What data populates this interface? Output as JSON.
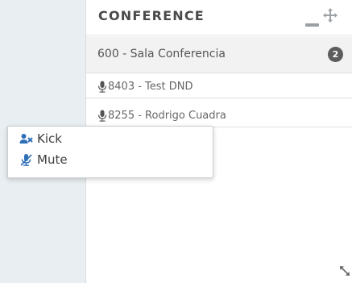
{
  "panel": {
    "title": "CONFERENCE",
    "icons": [
      "minimize-icon",
      "move-icon",
      "resize-icon"
    ]
  },
  "room": {
    "label": "600 - Sala Conferencia",
    "member_count": "2"
  },
  "members": [
    {
      "label": "8403 - Test DND",
      "icon": "microphone-icon"
    },
    {
      "label": "8255 - Rodrigo Cuadra",
      "icon": "microphone-icon"
    }
  ],
  "context_menu": {
    "items": [
      {
        "label": "Kick",
        "icon": "user-remove-icon"
      },
      {
        "label": "Mute",
        "icon": "microphone-mute-icon"
      }
    ]
  },
  "colors": {
    "sidebar_bg": "#e8eef1",
    "icon_blue": "#2f6fb8",
    "badge_bg": "#5c5c5c",
    "room_row_bg": "#f2f2f2"
  }
}
